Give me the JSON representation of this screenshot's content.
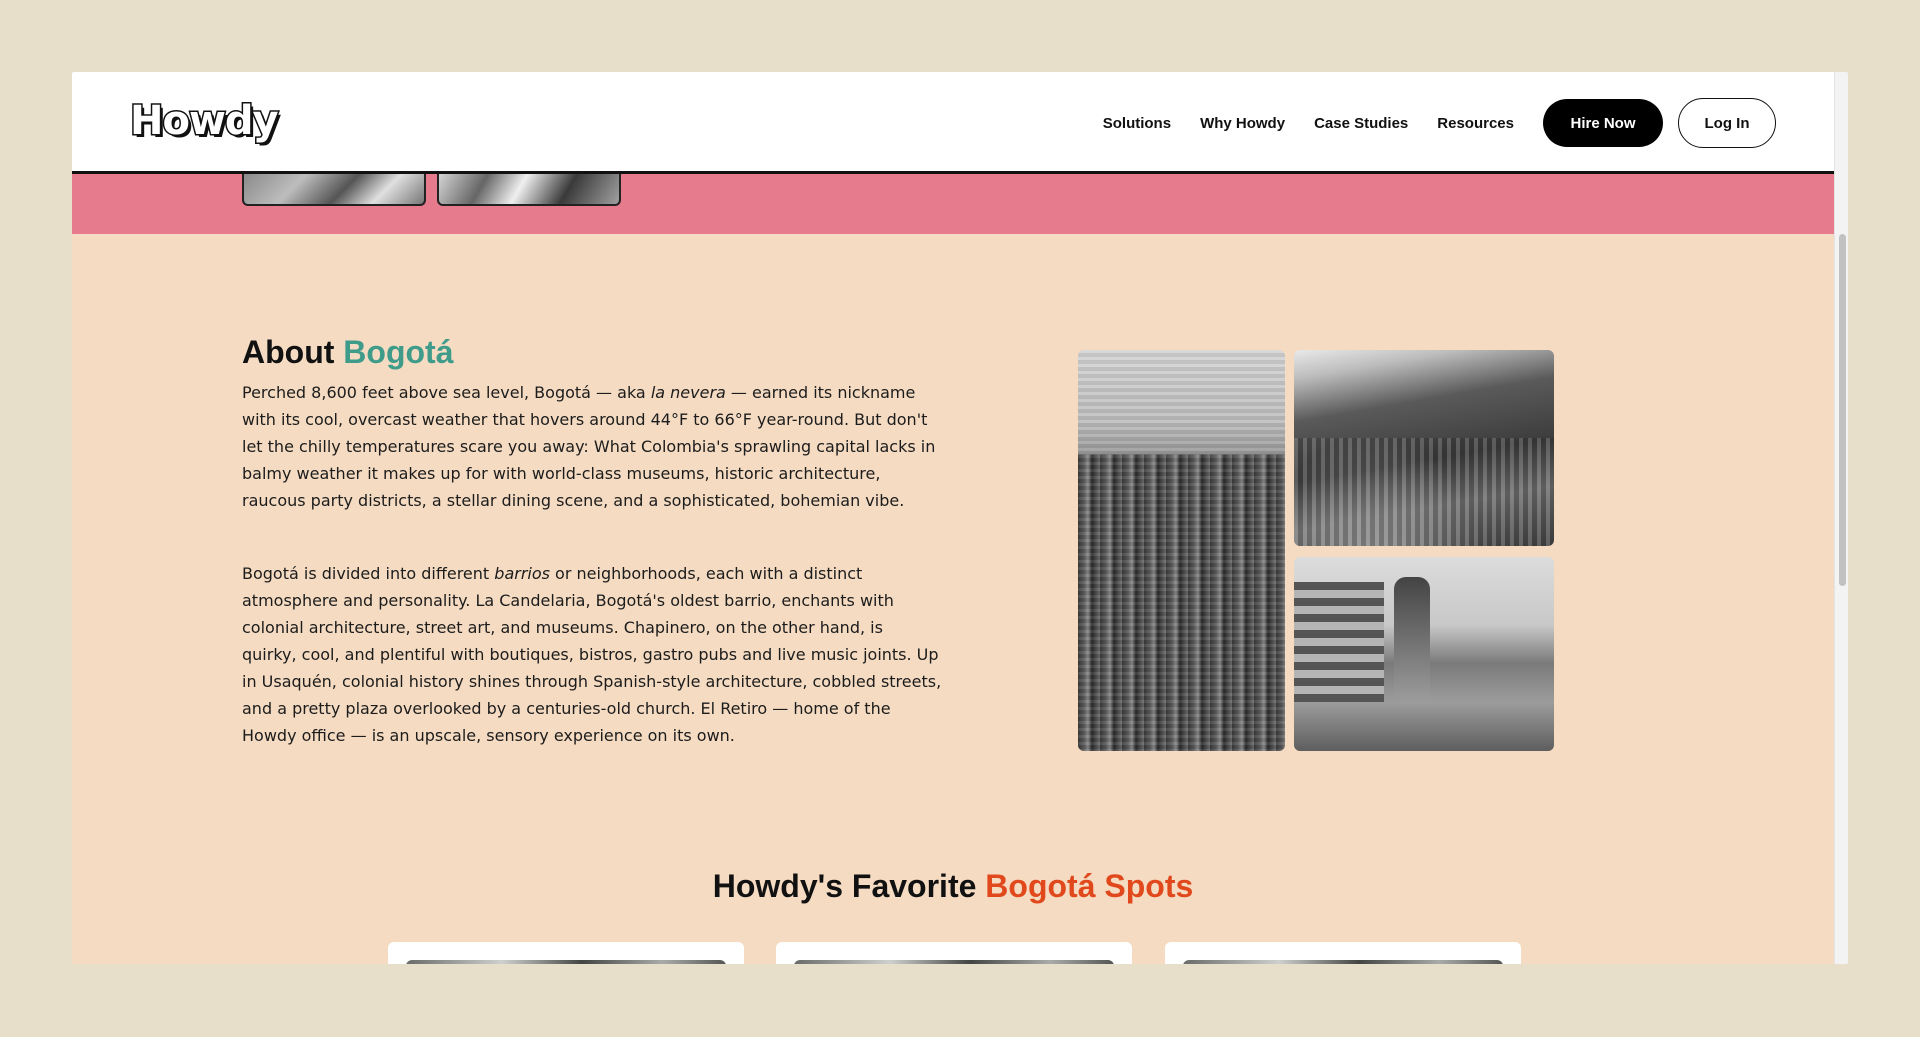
{
  "nav": {
    "logo": "Howdy",
    "links": [
      "Solutions",
      "Why Howdy",
      "Case Studies",
      "Resources"
    ],
    "hire_label": "Hire Now",
    "login_label": "Log In"
  },
  "about": {
    "heading_prefix": "About ",
    "heading_accent": "Bogotá",
    "para1": {
      "a": "Perched 8,600 feet above sea level, Bogotá — aka ",
      "em": "la nevera",
      "b": " — earned its nickname with its cool, overcast weather that hovers around 44°F to 66°F year-round. But don't let the chilly temperatures scare you away: What Colombia's sprawling capital lacks in balmy weather it makes up for with world-class museums, historic architecture, raucous party districts, a stellar dining scene, and a sophisticated, bohemian vibe."
    },
    "para2": {
      "a": "Bogotá is divided into different ",
      "em": "barrios",
      "b": " or neighborhoods, each with a distinct atmosphere and personality. La Candelaria, Bogotá's oldest barrio, enchants with colonial architecture, street art, and museums. Chapinero, on the other hand, is quirky, cool, and plentiful with boutiques, bistros, gastro pubs and live music joints. Up in Usaquén, colonial history shines through Spanish-style architecture, cobbled streets, and a pretty plaza overlooked by a centuries-old church. El Retiro — home of the Howdy office — is an upscale, sensory experience on its own."
    }
  },
  "favorites": {
    "heading_prefix": "Howdy's Favorite ",
    "heading_accent": "Bogotá Spots"
  },
  "colors": {
    "page_bg": "#e8dfcb",
    "section_bg": "#f4dbc2",
    "pink_band": "#e57b8d",
    "accent_teal": "#3f9c8a",
    "accent_orange": "#e1491d"
  }
}
